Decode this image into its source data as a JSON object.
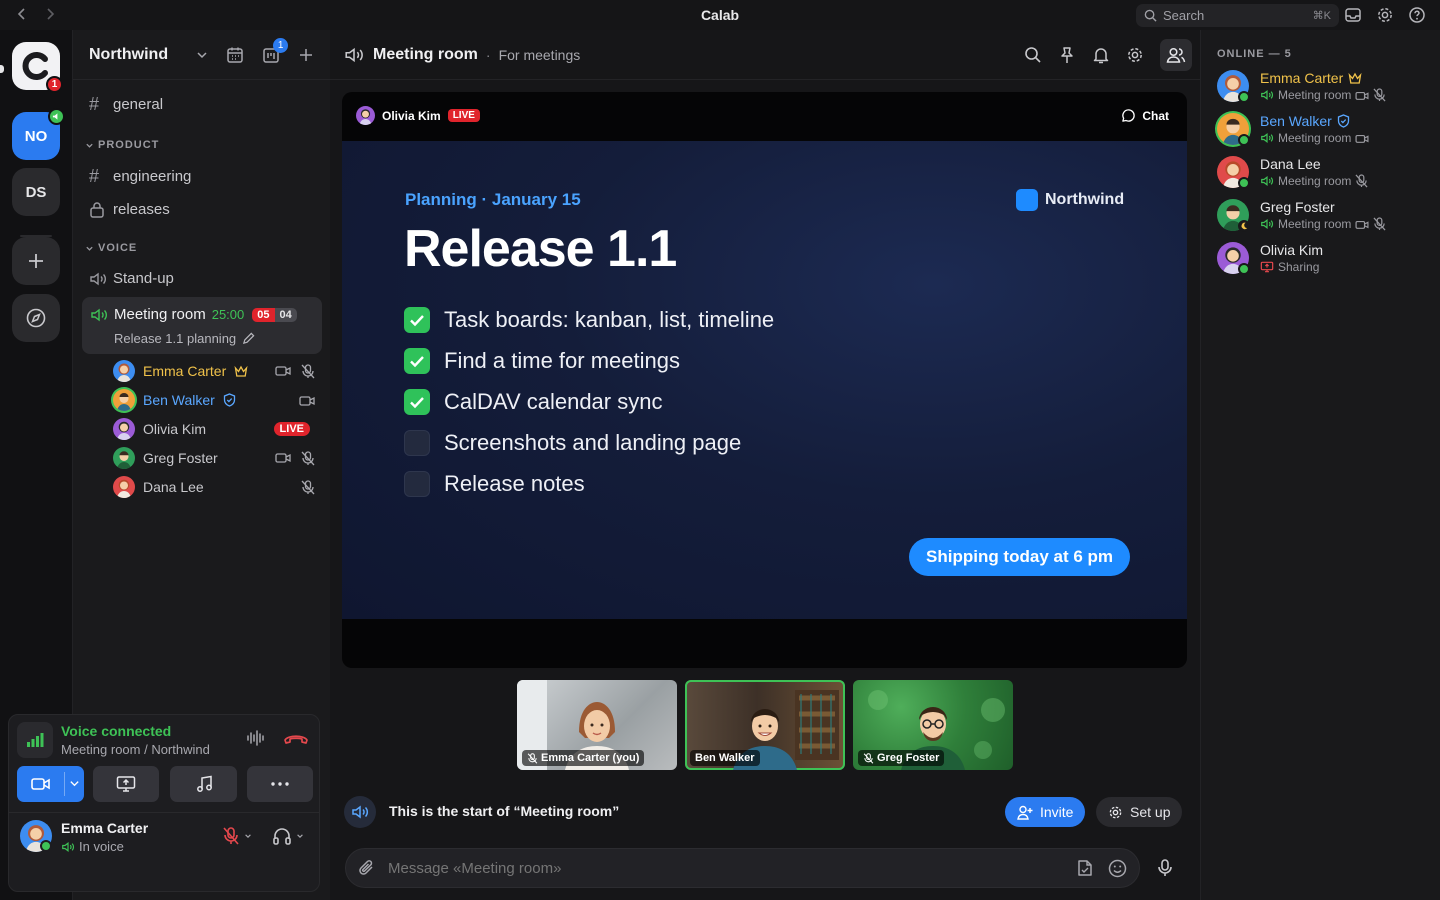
{
  "app": {
    "title": "Calab"
  },
  "search": {
    "label": "Search",
    "shortcut": "⌘K"
  },
  "rail": {
    "logo_badge": "1",
    "servers": [
      {
        "initials": "NO",
        "active": true
      },
      {
        "initials": "DS",
        "active": false
      }
    ]
  },
  "sidebar": {
    "workspace": "Northwind",
    "calendar_badge": "1",
    "channels": [
      {
        "name": "general"
      }
    ],
    "categories": [
      {
        "name": "PRODUCT",
        "channels": [
          {
            "name": "engineering"
          },
          {
            "name": "releases"
          }
        ]
      },
      {
        "name": "VOICE",
        "channels": [
          {
            "name": "Stand-up"
          }
        ]
      }
    ],
    "meeting": {
      "name": "Meeting room",
      "timer": "25:00",
      "count_a": "05",
      "count_b": "04",
      "topic": "Release 1.1 planning"
    },
    "voice_users": [
      {
        "name": "Emma Carter",
        "color": "#f0c24a",
        "crown": true
      },
      {
        "name": "Ben Walker",
        "color": "#5aa7ff",
        "verified": true
      },
      {
        "name": "Olivia Kim",
        "color": "#c8c8cc",
        "live": "LIVE"
      },
      {
        "name": "Greg Foster",
        "color": "#c8c8cc"
      },
      {
        "name": "Dana Lee",
        "color": "#c8c8cc"
      }
    ]
  },
  "voice_panel": {
    "status": "Voice connected",
    "location": "Meeting room / Northwind",
    "user_name": "Emma Carter",
    "user_status": "In voice"
  },
  "header": {
    "channel": "Meeting room",
    "separator": "·",
    "description": "For meetings"
  },
  "stream": {
    "presenter": "Olivia Kim",
    "live": "LIVE",
    "chat_label": "Chat",
    "slide": {
      "kicker": "Planning · January 15",
      "brand": "Northwind",
      "title": "Release 1.1",
      "tasks": [
        {
          "text": "Task boards: kanban, list, timeline",
          "done": true
        },
        {
          "text": "Find a time for meetings",
          "done": true
        },
        {
          "text": "CalDAV calendar sync",
          "done": true
        },
        {
          "text": "Screenshots and landing page",
          "done": false
        },
        {
          "text": "Release notes",
          "done": false
        }
      ],
      "cta": "Shipping today at 6 pm"
    }
  },
  "tiles": [
    {
      "name": "Emma Carter (you)",
      "muted": true
    },
    {
      "name": "Ben Walker",
      "muted": false,
      "speaking": true
    },
    {
      "name": "Greg Foster",
      "muted": true
    }
  ],
  "channel_start": {
    "text": "This is the start of “Meeting room”",
    "invite": "Invite",
    "setup": "Set up"
  },
  "composer": {
    "placeholder": "Message «Meeting room»"
  },
  "online": {
    "header": "ONLINE — 5",
    "users": [
      {
        "name": "Emma Carter",
        "status": "Meeting room",
        "color": "#f0c24a"
      },
      {
        "name": "Ben Walker",
        "status": "Meeting room",
        "color": "#5aa7ff"
      },
      {
        "name": "Dana Lee",
        "status": "Meeting room",
        "color": "#e6e6e8"
      },
      {
        "name": "Greg Foster",
        "status": "Meeting room",
        "color": "#e6e6e8"
      },
      {
        "name": "Olivia Kim",
        "status": "Sharing",
        "color": "#e6e6e8"
      }
    ]
  },
  "colors": {
    "accent": "#2b7bf0",
    "live": "#e0242c",
    "voice_green": "#3ec256",
    "hangup": "#e5484d"
  }
}
